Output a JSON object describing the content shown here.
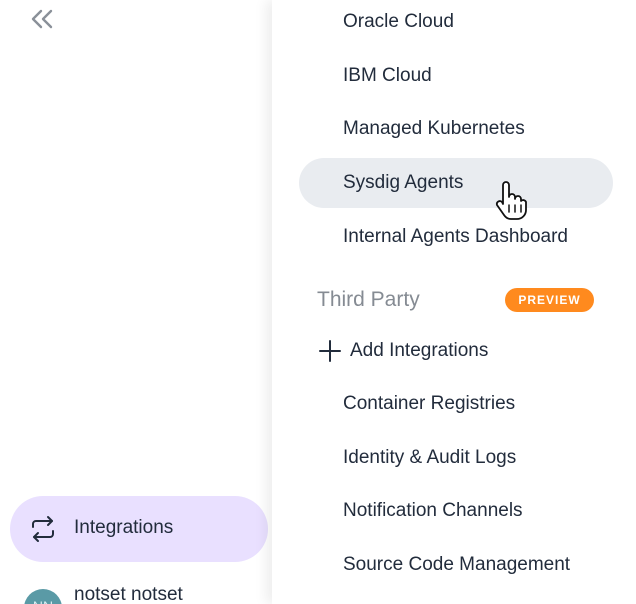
{
  "rail": {
    "collapse_icon": "double-chevron-left-icon",
    "active_item": {
      "label": "Integrations",
      "icon": "integrations-swap-icon",
      "background": "#e9e0ff"
    },
    "user": {
      "initials": "NN",
      "name": "notset notset"
    }
  },
  "flyout": {
    "items_top": [
      {
        "label": "Oracle Cloud"
      },
      {
        "label": "IBM Cloud"
      },
      {
        "label": "Managed Kubernetes"
      },
      {
        "label": "Sysdig Agents",
        "hovered": true
      },
      {
        "label": "Internal Agents Dashboard"
      }
    ],
    "section": {
      "title": "Third Party",
      "badge": "PREVIEW",
      "badge_color": "#ff8a1e"
    },
    "add_action": {
      "label": "Add Integrations",
      "icon": "plus-icon"
    },
    "items_third_party": [
      {
        "label": "Container Registries"
      },
      {
        "label": "Identity & Audit Logs"
      },
      {
        "label": "Notification Channels"
      },
      {
        "label": "Source Code Management"
      }
    ]
  },
  "colors": {
    "text_primary": "#222c3c",
    "text_muted": "#858b93",
    "hover_background": "#e9ecf0"
  }
}
